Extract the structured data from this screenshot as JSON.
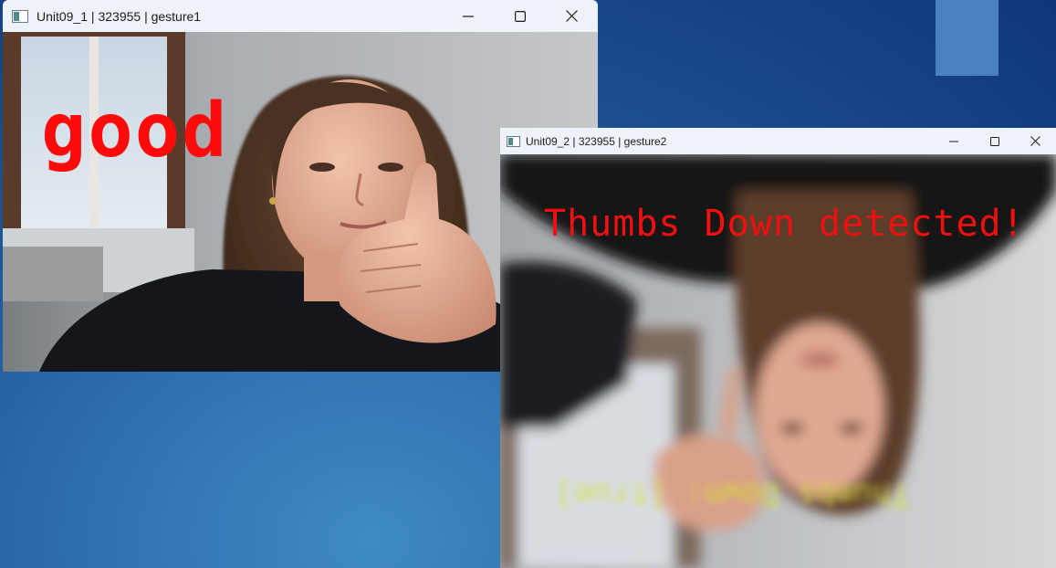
{
  "desktop": {
    "background_color": "#1c4f8f",
    "tile_color": "#4a80bf"
  },
  "windows": [
    {
      "title": "Unit09_1 | 323955 | gesture1",
      "icon": "app-window-icon",
      "controls": [
        "minimize-icon",
        "maximize-icon",
        "close-icon"
      ],
      "overlay_text": "good",
      "overlay_color": "#ff0a0a"
    },
    {
      "title": "Unit09_2 | 323955 | gesture2",
      "icon": "app-window-icon",
      "controls": [
        "minimize-icon",
        "maximize-icon",
        "close-icon"
      ],
      "overlay_text": "Thumbs Down detected!",
      "overlay_color": "#f01010",
      "blurred_text": "Thumbs Down: [true]",
      "view": "flipped-vertical"
    }
  ]
}
